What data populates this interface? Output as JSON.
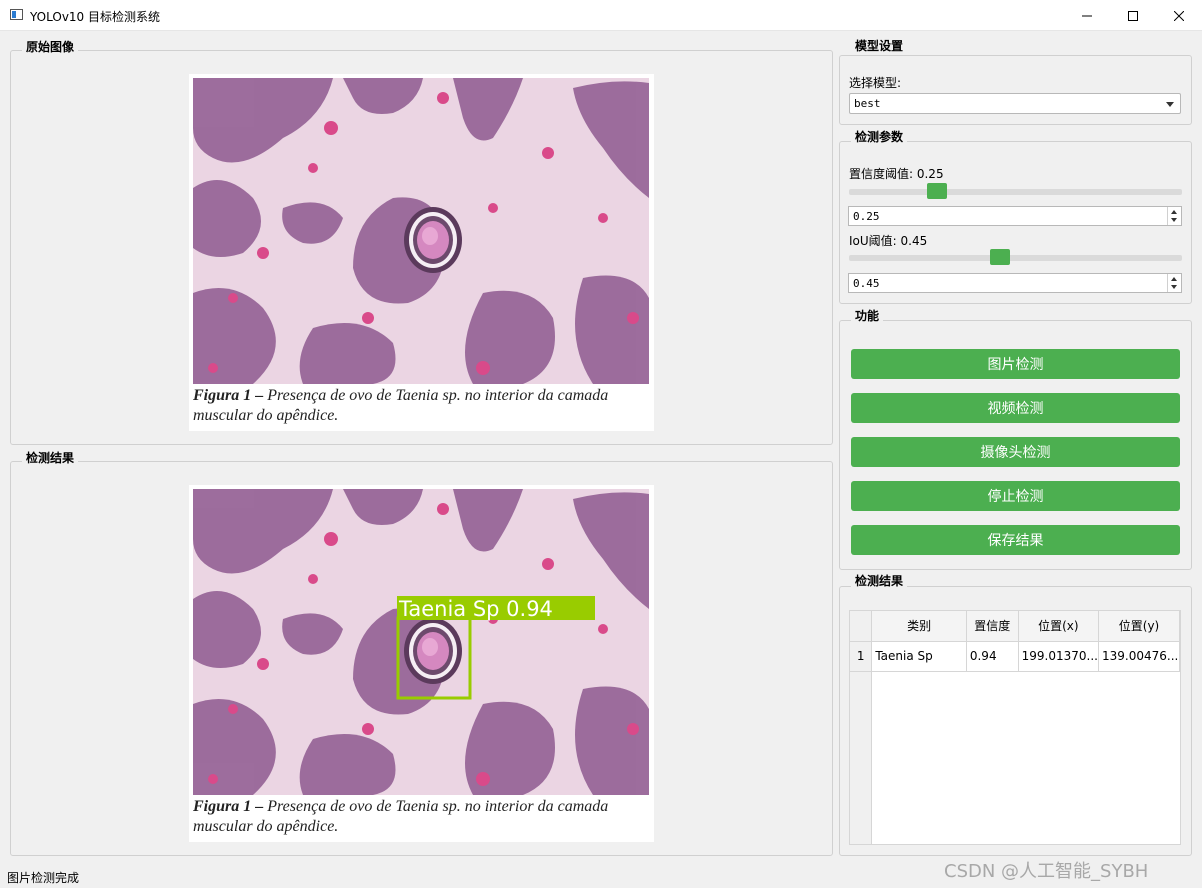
{
  "window": {
    "title": "YOLOv10 目标检测系统"
  },
  "original": {
    "group_title": "原始图像",
    "caption_bold": "Figura 1 –",
    "caption_rest": " Presença de ovo de Taenia sp. no interior da camada",
    "caption_line2": "muscular do apêndice."
  },
  "result_image": {
    "group_title": "检测结果",
    "detection_label": "Taenia Sp 0.94",
    "box_color": "#99cc00",
    "caption_bold": "Figura 1 –",
    "caption_rest": " Presença de ovo de Taenia sp. no interior da camada",
    "caption_line2": "muscular do apêndice."
  },
  "model": {
    "group_title": "模型设置",
    "label": "选择模型:",
    "selected": "best"
  },
  "params": {
    "group_title": "检测参数",
    "conf_label": "置信度阈值: 0.25",
    "conf_value": "0.25",
    "conf_fraction": 0.25,
    "iou_label": "IoU阈值: 0.45",
    "iou_value": "0.45",
    "iou_fraction": 0.45,
    "accent_color": "#4caf50"
  },
  "functions": {
    "group_title": "功能",
    "buttons": [
      "图片检测",
      "视频检测",
      "摄像头检测",
      "停止检测",
      "保存结果"
    ]
  },
  "results_table": {
    "group_title": "检测结果",
    "headers": [
      "类别",
      "置信度",
      "位置(x)",
      "位置(y)"
    ],
    "rows": [
      {
        "index": "1",
        "cells": [
          "Taenia Sp",
          "0.94",
          "199.01370...",
          "139.00476..."
        ]
      }
    ]
  },
  "status": {
    "text": "图片检测完成"
  },
  "watermark": "CSDN @人工智能_SYBH"
}
